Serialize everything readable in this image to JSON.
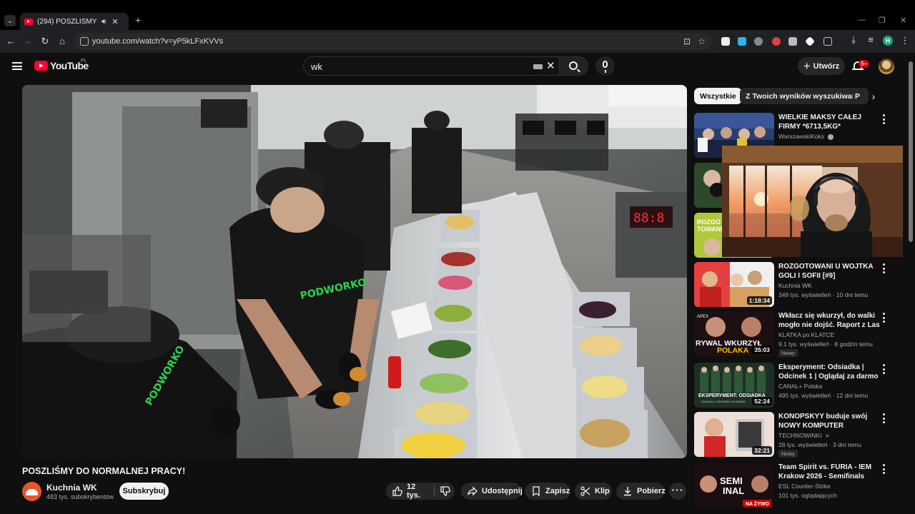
{
  "browser": {
    "tab_title": "(294) POSZLIŚMY DO NORMALNEJ PRACY!",
    "tab_close": "✕",
    "new_tab": "+",
    "url": "youtube.com/watch?v=yP5kLFxKVVs",
    "profile_initial": "H",
    "win_min": "—",
    "win_max": "❐",
    "win_close": "✕"
  },
  "header": {
    "logo_text": "YouTube",
    "country_code": "PL",
    "search_value": "wk",
    "create_label": "Utwórz",
    "notif_count": "9+"
  },
  "video": {
    "title": "POSZLIŚMY DO NORMALNEJ PRACY!",
    "channel_name": "Kuchnia WK",
    "channel_subs": "483 tys. subskrybentów",
    "subscribe_label": "Subskrybuj",
    "likes": "12 tys.",
    "share_label": "Udostępnij",
    "save_label": "Zapisz",
    "clip_label": "Klip",
    "download_label": "Pobierz"
  },
  "sidebar": {
    "chips": [
      "Wszystkie",
      "Z Twoich wyników wyszukiwania",
      "P"
    ],
    "recommendations": [
      {
        "title": "WIELKIE MAKSY CAŁEJ FIRMY *6713,5KG*",
        "channel": "WarszawskiKoks",
        "verified": true,
        "meta": "",
        "duration": "",
        "badge": ""
      },
      {
        "title": "",
        "channel": "",
        "verified": false,
        "meta": "",
        "duration": "",
        "badge": ""
      },
      {
        "title": "",
        "channel": "",
        "verified": false,
        "meta": "",
        "duration": "",
        "badge": ""
      },
      {
        "title": "ROZGOTOWANI U WOJTKA GOLI I SOFII [#9]",
        "channel": "Kuchnia WK",
        "verified": false,
        "meta": "349 tys. wyświetleń · 10 dni temu",
        "duration": "1:18:34",
        "badge": ""
      },
      {
        "title": "Wkłacz się wkurzył, do walki mogło nie dojść. Raport z Las ...",
        "channel": "KLATKA po KLATCE",
        "verified": false,
        "meta": "9,1 tys. wyświetleń · 8 godzin temu",
        "duration": "35:03",
        "badge": "Nowy"
      },
      {
        "title": "Eksperyment: Odsiadka | Odcinek 1 | Oglądaj za darmo",
        "channel": "CANAL+ Polska",
        "verified": false,
        "meta": "495 tys. wyświetleń · 12 dni temu",
        "duration": "52:24",
        "badge": ""
      },
      {
        "title": "KONOPSKYY buduje swój NOWY KOMPUTER",
        "channel": "TECHNOWINKI",
        "verified": false,
        "meta": "28 tys. wyświetleń · 3 dni temu",
        "duration": "32:21",
        "badge": "Nowy"
      },
      {
        "title": "Team Spirit vs. FURIA - IEM Krakow 2026 - Semifinals",
        "channel": "ESL Counter-Strike",
        "verified": false,
        "meta": "101 tys. oglądających",
        "duration": "",
        "badge": ""
      }
    ]
  },
  "thumb_text": {
    "apex": "APEX",
    "rywal_line1": "RYWAL WKURZYŁ",
    "rywal_line2": "POLAKA",
    "ekspe_line1": "EKSPERYMENT: ODSIADKA",
    "ekspe_line2": "DOLADUJ I ODCINEK ZA DARMO",
    "semi_line1": "SEMI",
    "semi_line2": "INAL",
    "live": "NA ŻYWO",
    "rozgo_line1": "ROZGO",
    "rozgo_line2": "TOWANI"
  },
  "colors": {
    "accent": "#ff0033",
    "background": "#0f0f0f",
    "surface": "#272727",
    "green_brand": "#2bd24a"
  }
}
